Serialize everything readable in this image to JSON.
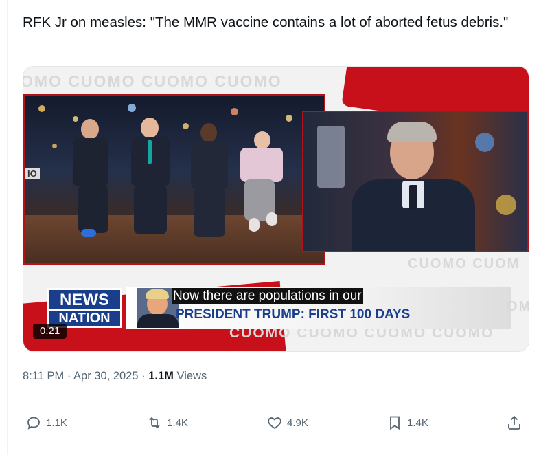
{
  "tweet": {
    "text": "RFK Jr on measles: \"The MMR vaccine contains a lot of aborted fetus debris.\""
  },
  "video": {
    "caption": "Now there are populations in our",
    "duration": "0:21",
    "headline": "PRESIDENT TRUMP: FIRST 100 DAYS",
    "logo_line1": "NEWS",
    "logo_line2": "NATION",
    "watermark_top": "OMO CUOMO CUOMO CUOMO",
    "watermark_right": "CUOMO CUOM",
    "watermark_bottom": "CUOMO CUOMO CUOMO CUOMO",
    "watermark_side": "OM",
    "studio_logo": "IO"
  },
  "meta": {
    "time": "8:11 PM",
    "separator": "·",
    "date": "Apr 30, 2025",
    "views_count": "1.1M",
    "views_label": "Views"
  },
  "actions": {
    "replies": "1.1K",
    "reposts": "1.4K",
    "likes": "4.9K",
    "bookmarks": "1.4K"
  },
  "colors": {
    "text": "#0f1419",
    "secondary": "#536471",
    "accent_red": "#c8101a",
    "news_blue": "#1a3e8c"
  },
  "icons": [
    "reply-icon",
    "repost-icon",
    "like-icon",
    "bookmark-icon",
    "share-icon"
  ]
}
